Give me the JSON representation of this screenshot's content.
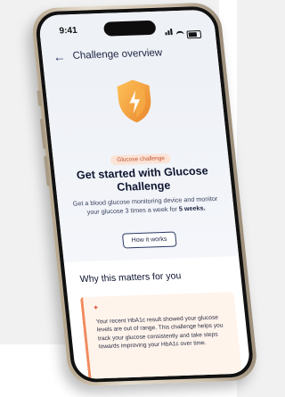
{
  "status": {
    "time": "9:41"
  },
  "nav": {
    "back_icon": "arrow-left-icon",
    "title": "Challenge overview"
  },
  "hero": {
    "icon": "shield-icon",
    "pill": "Glucose challenge",
    "title": "Get started with Glucose Challenge",
    "desc_prefix": "Get a blood glucose monitoring device and monitor your glucose 3 times a week for ",
    "desc_bold": "5 weeks.",
    "button": "How it works"
  },
  "why": {
    "title": "Why this matters for you",
    "icon": "sparkle-icon",
    "text": "Your recent HbA1c result showed your glucose levels are out of range. This challenge helps you track your glucose consistently and take steps towards improving your HbA1c over time."
  },
  "colors": {
    "accent": "#f08a5d",
    "shield": "#f2a23a",
    "navy": "#1c2340"
  }
}
